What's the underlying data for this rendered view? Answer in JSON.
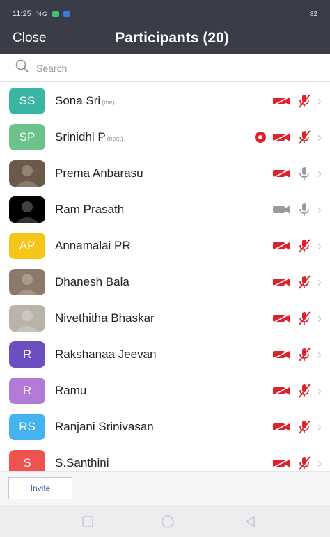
{
  "status_bar": {
    "time": "11:25",
    "signal": "\"4G",
    "battery": "82"
  },
  "header": {
    "close_label": "Close",
    "title": "Participants (20)"
  },
  "search": {
    "placeholder": "Search"
  },
  "participants": [
    {
      "initials": "SS",
      "name": "Sona Sri",
      "tag": "(me)",
      "avatar_color": "#3ab5a3",
      "video": "off",
      "mic": "muted",
      "record": false
    },
    {
      "initials": "SP",
      "name": "Srinidhi P",
      "tag": "(host)",
      "avatar_color": "#6cc28a",
      "video": "off",
      "mic": "muted",
      "record": true
    },
    {
      "initials": "",
      "name": "Prema Anbarasu",
      "tag": "",
      "avatar_color": "#6b5a4a",
      "photo": true,
      "video": "off",
      "mic": "on",
      "record": false
    },
    {
      "initials": "",
      "name": "Ram Prasath",
      "tag": "",
      "avatar_color": "#000000",
      "photo": true,
      "video": "on",
      "mic": "on",
      "record": false
    },
    {
      "initials": "AP",
      "name": "Annamalai PR",
      "tag": "",
      "avatar_color": "#f5c518",
      "video": "off",
      "mic": "muted",
      "record": false
    },
    {
      "initials": "",
      "name": "Dhanesh Bala",
      "tag": "",
      "avatar_color": "#8b7a6a",
      "photo": true,
      "video": "off",
      "mic": "muted",
      "record": false
    },
    {
      "initials": "",
      "name": "Nivethitha Bhaskar",
      "tag": "",
      "avatar_color": "#b9b3aa",
      "photo": true,
      "video": "off",
      "mic": "muted",
      "record": false
    },
    {
      "initials": "R",
      "name": "Rakshanaa Jeevan",
      "tag": "",
      "avatar_color": "#6b4fc0",
      "video": "off",
      "mic": "muted",
      "record": false
    },
    {
      "initials": "R",
      "name": "Ramu",
      "tag": "",
      "avatar_color": "#b07ad6",
      "video": "off",
      "mic": "muted",
      "record": false
    },
    {
      "initials": "RS",
      "name": "Ranjani Srinivasan",
      "tag": "",
      "avatar_color": "#45b3f0",
      "video": "off",
      "mic": "muted",
      "record": false
    },
    {
      "initials": "S",
      "name": "S.Santhini",
      "tag": "",
      "avatar_color": "#ef5350",
      "video": "off",
      "mic": "muted",
      "record": false
    }
  ],
  "footer": {
    "invite_label": "Invite"
  },
  "colors": {
    "header_bg": "#3a3c48",
    "muted_red": "#e0202a",
    "icon_gray": "#9a9aa0",
    "invite_text": "#3b5aa7"
  }
}
